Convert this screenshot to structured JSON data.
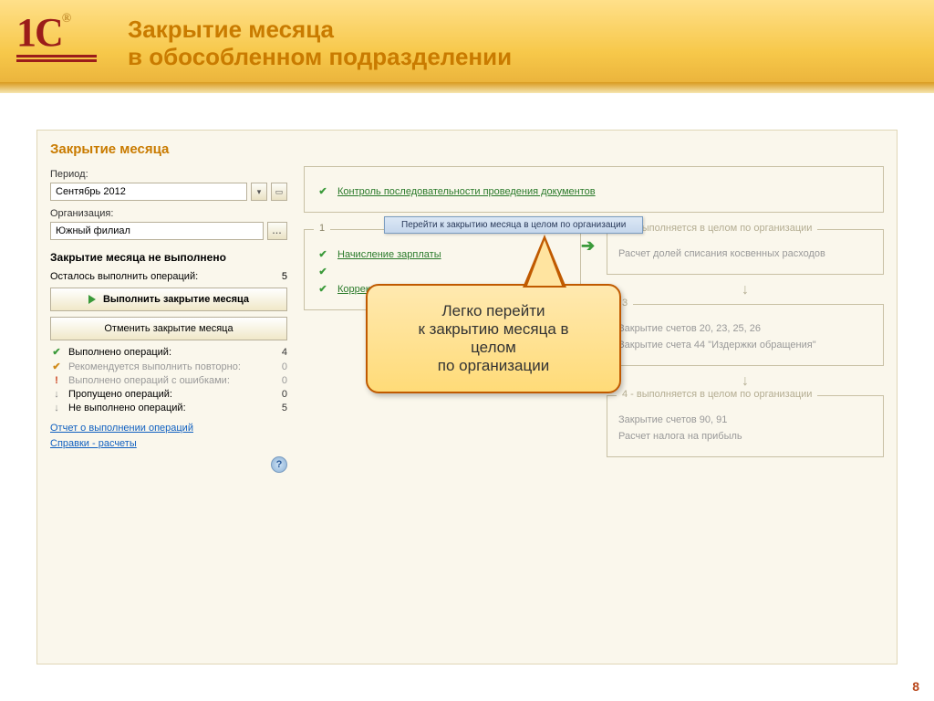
{
  "header": {
    "title_l1": "Закрытие месяца",
    "title_l2": "в обособленном подразделении"
  },
  "app": {
    "title": "Закрытие месяца",
    "period_label": "Период:",
    "period_value": "Сентябрь 2012",
    "org_label": "Организация:",
    "org_value": "Южный филиал",
    "status_heading": "Закрытие месяца не выполнено",
    "remaining_label": "Осталось выполнить операций:",
    "remaining_count": "5",
    "btn_run": "Выполнить закрытие месяца",
    "btn_cancel": "Отменить закрытие месяца",
    "stats": [
      {
        "icon": "ok",
        "label": "Выполнено операций:",
        "count": "4",
        "muted": false
      },
      {
        "icon": "warn",
        "label": "Рекомендуется выполнить повторно:",
        "count": "0",
        "muted": true
      },
      {
        "icon": "err",
        "label": "Выполнено операций с ошибками:",
        "count": "0",
        "muted": true
      },
      {
        "icon": "none",
        "label": "Пропущено операций:",
        "count": "0",
        "muted": false
      },
      {
        "icon": "none",
        "label": "Не выполнено операций:",
        "count": "5",
        "muted": false
      }
    ],
    "link_report": "Отчет о выполнении операций",
    "link_refs": "Справки - расчеты"
  },
  "right": {
    "box0_op": "Контроль последовательности проведения документов",
    "box1_label": "1",
    "box1_ops": [
      "Начисление зарплаты",
      "",
      "Корректировка стоимости номенклатуры"
    ],
    "box2_label": "2  -  выполняется в целом по организации",
    "box2_ops": [
      "Расчет долей списания косвенных расходов"
    ],
    "box3_label": "3",
    "box3_ops": [
      "Закрытие счетов 20, 23, 25, 26",
      "Закрытие счета 44 \"Издержки обращения\""
    ],
    "box4_label": "4  -  выполняется в целом по организации",
    "box4_ops": [
      "Закрытие счетов 90, 91",
      "Расчет налога на прибыль"
    ]
  },
  "popup": "Перейти к закрытию месяца в целом по организации",
  "callout": {
    "l1": "Легко перейти",
    "l2": "к закрытию месяца в",
    "l3": "целом",
    "l4": "по организации"
  },
  "page": "8"
}
